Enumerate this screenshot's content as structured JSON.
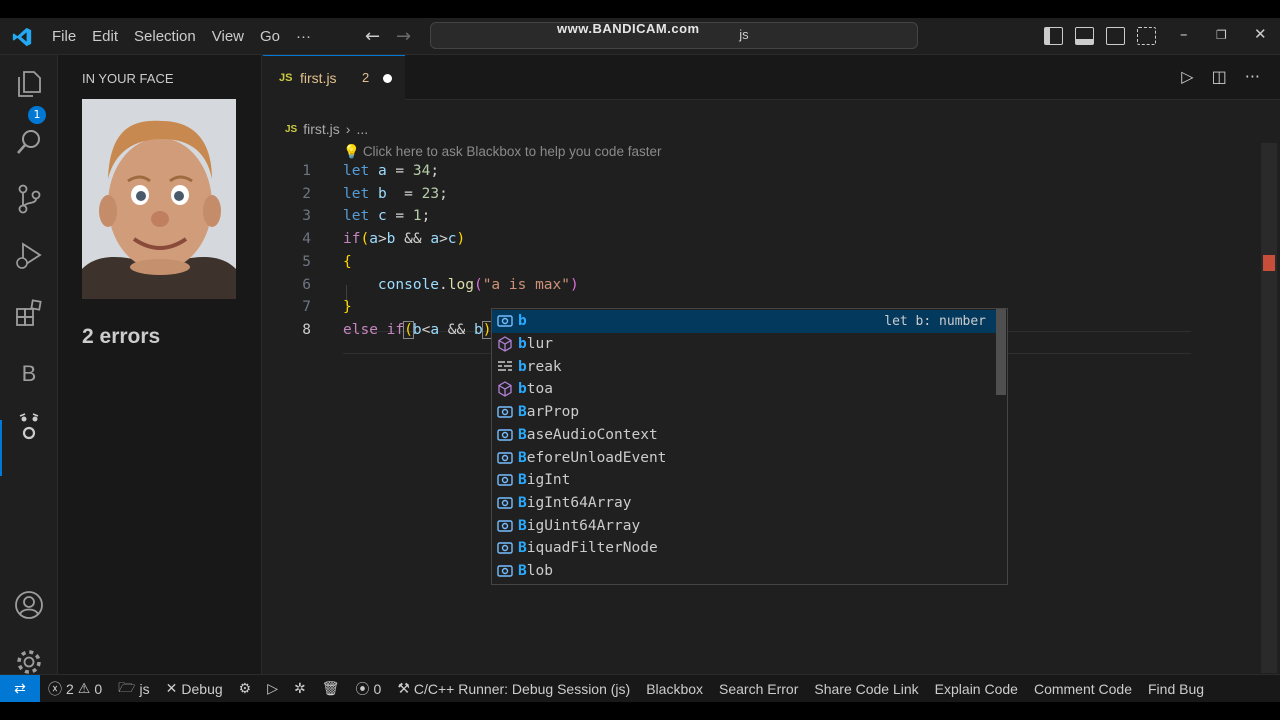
{
  "watermark": "www.BANDICAM.com",
  "titlebar": {
    "menu": [
      "File",
      "Edit",
      "Selection",
      "View",
      "Go"
    ],
    "more": "···",
    "search_text": "js"
  },
  "activity": {
    "explorer_badge": "1",
    "blackbox_letter": "B"
  },
  "sidepanel": {
    "title": "IN YOUR FACE",
    "errors_text": "2 errors"
  },
  "tab": {
    "icon": "JS",
    "name": "first.js",
    "problem_count": "2"
  },
  "breadcrumb": {
    "icon": "JS",
    "file": "first.js",
    "separator": "›",
    "rest": "..."
  },
  "hint": "Click here to ask Blackbox to help you code faster",
  "code_lines": [
    {
      "n": "1"
    },
    {
      "n": "2"
    },
    {
      "n": "3"
    },
    {
      "n": "4"
    },
    {
      "n": "5"
    },
    {
      "n": "6"
    },
    {
      "n": "7"
    },
    {
      "n": "8"
    }
  ],
  "suggestions": [
    {
      "prefix": "b",
      "rest": "",
      "kind": "variable",
      "detail": "let b: number"
    },
    {
      "prefix": "b",
      "rest": "lur",
      "kind": "method"
    },
    {
      "prefix": "b",
      "rest": "reak",
      "kind": "keyword"
    },
    {
      "prefix": "b",
      "rest": "toa",
      "kind": "method"
    },
    {
      "prefix": "B",
      "rest": "arProp",
      "kind": "variable"
    },
    {
      "prefix": "B",
      "rest": "aseAudioContext",
      "kind": "variable"
    },
    {
      "prefix": "B",
      "rest": "eforeUnloadEvent",
      "kind": "variable"
    },
    {
      "prefix": "B",
      "rest": "igInt",
      "kind": "variable"
    },
    {
      "prefix": "B",
      "rest": "igInt64Array",
      "kind": "variable"
    },
    {
      "prefix": "B",
      "rest": "igUint64Array",
      "kind": "variable"
    },
    {
      "prefix": "B",
      "rest": "iquadFilterNode",
      "kind": "variable"
    },
    {
      "prefix": "B",
      "rest": "lob",
      "kind": "variable"
    }
  ],
  "statusbar": {
    "errors": "2",
    "warnings": "0",
    "workspace": "js",
    "debug": "Debug",
    "ports": "0",
    "runner": "C/C++ Runner: Debug Session (js)",
    "blackbox": "Blackbox",
    "search_error": "Search Error",
    "share": "Share Code Link",
    "explain": "Explain Code",
    "comment": "Comment Code",
    "find_bug": "Find Bug"
  },
  "colors": {
    "accent": "#0078d4",
    "modified_tab": "#e2c08d",
    "suggest_highlight": "#2aaaff"
  }
}
